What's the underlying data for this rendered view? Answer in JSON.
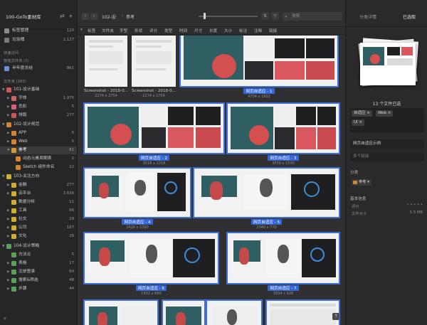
{
  "sidebar": {
    "library_name": "100-GoTo素材库",
    "top_items": [
      {
        "label": "标签管理",
        "count": "120"
      },
      {
        "label": "垃圾桶",
        "count": "2,127"
      }
    ],
    "quick_access_title": "快速访问",
    "smart_folders_title": "智能文件夹 (1)",
    "smart_items": [
      {
        "label": "半年度总结",
        "count": "861"
      }
    ],
    "folders_title": "文件夹 (283)",
    "folders": [
      {
        "label": "101-设计基础",
        "count": ""
      },
      {
        "label": "字体",
        "count": "1,975"
      },
      {
        "label": "色彩",
        "count": "5"
      },
      {
        "label": "排版",
        "count": "277"
      },
      {
        "label": "102-设计规范",
        "count": ""
      },
      {
        "label": "APP",
        "count": "5"
      },
      {
        "label": "Web",
        "count": "5"
      },
      {
        "label": "参考",
        "count": "81"
      },
      {
        "label": "动态元素周期表",
        "count": "2"
      },
      {
        "label": "Sketch 组件命名",
        "count": "22"
      },
      {
        "label": "103-关注方向",
        "count": ""
      },
      {
        "label": "金融",
        "count": "277"
      },
      {
        "label": "云平台",
        "count": "3,636"
      },
      {
        "label": "数据分析",
        "count": "11"
      },
      {
        "label": "工具",
        "count": "96"
      },
      {
        "label": "社交",
        "count": "29"
      },
      {
        "label": "公司",
        "count": "187"
      },
      {
        "label": "文化",
        "count": "26"
      },
      {
        "label": "104-设计策略",
        "count": ""
      },
      {
        "label": "方法论",
        "count": "5"
      },
      {
        "label": "表格",
        "count": "17"
      },
      {
        "label": "注册登录",
        "count": "60"
      },
      {
        "label": "搜索&筛选",
        "count": "48"
      },
      {
        "label": "步骤",
        "count": "44"
      }
    ]
  },
  "toolbar": {
    "breadcrumb_parent": "102-设·",
    "breadcrumb_current": "参考",
    "search_placeholder": "搜索"
  },
  "filters": [
    "标签",
    "文件夹",
    "字型",
    "形状",
    "评分",
    "类型",
    "时间",
    "尺寸",
    "长度",
    "大小",
    "标注",
    "注释",
    "链接"
  ],
  "items": [
    {
      "name": "Screenshot - 2018-0...",
      "dims": "2274 x 2754",
      "selected": false
    },
    {
      "name": "Screenshot - 2018-0...",
      "dims": "2274 x 2754",
      "selected": false
    },
    {
      "name": "网页自适应 - 1",
      "dims": "4704 x 1602",
      "selected": true
    },
    {
      "name": "网页自适应 - 2",
      "dims": "3518 x 1218",
      "selected": true
    },
    {
      "name": "网页自适应 - 3",
      "dims": "3550 x 1530",
      "selected": true
    },
    {
      "name": "网页自适应 - 4",
      "dims": "2426 x 1090",
      "selected": true
    },
    {
      "name": "网页自适应 - 5",
      "dims": "2340 x 770",
      "selected": true
    },
    {
      "name": "网页自适应 - 6",
      "dims": "1832 x 680",
      "selected": true
    },
    {
      "name": "网页自适应 - 7",
      "dims": "1834 x 928",
      "selected": true
    }
  ],
  "right_panel": {
    "tab_category_details": "分类详情",
    "tab_selected": "已选取",
    "selection_summary": "13 个文件已选",
    "tags": [
      "自适应",
      "Web",
      "UI"
    ],
    "note_placeholder": "网页自适应示例",
    "link_placeholder": "多个链接",
    "category_title": "分类",
    "category_folder": "参考",
    "basic_info_title": "基本信息",
    "rating_label": "评分",
    "rating_stars": "• • • • •",
    "file_size_label": "文件大小",
    "file_size_value": "5.5 MB"
  },
  "colors": {
    "selection_blue": "#3466d6",
    "folder_orange": "#c98a2a"
  }
}
